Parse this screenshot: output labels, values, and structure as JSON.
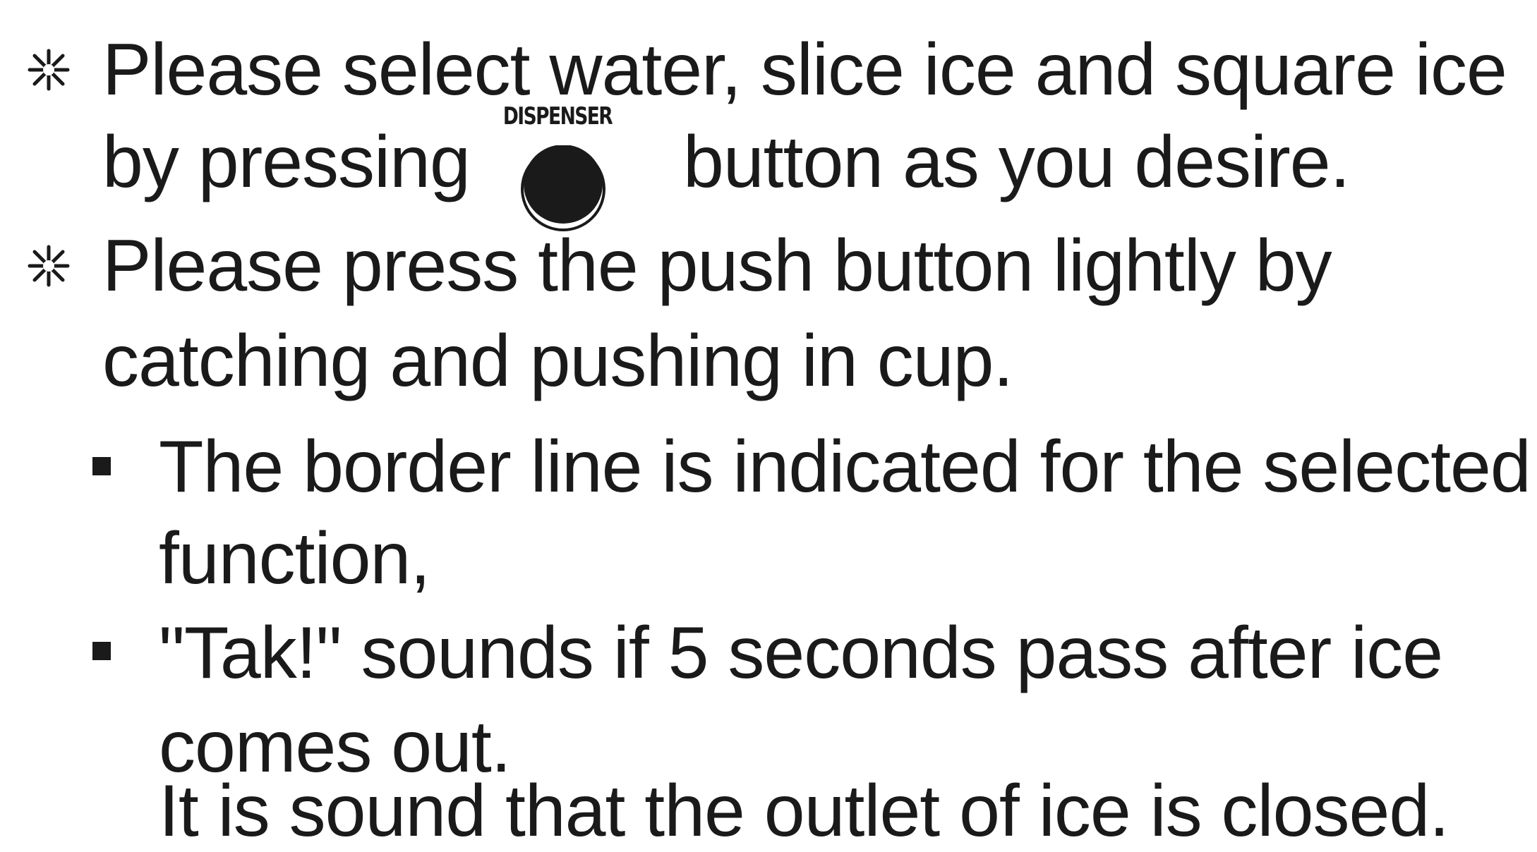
{
  "instructions": [
    {
      "lines": [
        "Please select water, slice ice and square ice",
        "by pressing",
        "button as you desire."
      ]
    },
    {
      "lines": [
        "Please press the push button lightly by",
        "catching and pushing in cup."
      ]
    }
  ],
  "dispenser_button": {
    "label": "DISPENSER",
    "icon": "round-button-icon"
  },
  "notes": [
    {
      "lines": [
        "The border line is indicated for the selected",
        "function,"
      ]
    },
    {
      "lines": [
        "\"Tak!\" sounds if 5 seconds pass after ice",
        "comes out.",
        "It is sound that the outlet of ice is closed."
      ]
    }
  ],
  "marks": {
    "note_symbol": "asterisk-note-icon",
    "bullet_symbol": "square-bullet-icon"
  }
}
